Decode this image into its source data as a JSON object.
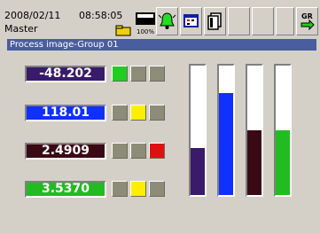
{
  "status": {
    "date": "2008/02/11",
    "time": "08:58:05",
    "mode": "Master",
    "memory": "100%"
  },
  "group_title": "Process image-Group 01",
  "channels": [
    {
      "value": "-48.202",
      "color": "#3a1a6a",
      "alarms": [
        "#22cc22",
        "#8c8c78",
        "#8c8c78"
      ],
      "bar_level": 0.36,
      "bar_color": "#3a1a6a"
    },
    {
      "value": "118.01",
      "color": "#1030ff",
      "alarms": [
        "#8c8c78",
        "#ffee00",
        "#8c8c78"
      ],
      "bar_level": 0.79,
      "bar_color": "#1030ff"
    },
    {
      "value": "2.4909",
      "color": "#3a0a14",
      "alarms": [
        "#8c8c78",
        "#8c8c78",
        "#dd1111"
      ],
      "bar_level": 0.5,
      "bar_color": "#3a0a14"
    },
    {
      "value": "3.5370",
      "color": "#22bb22",
      "alarms": [
        "#8c8c78",
        "#ffee00",
        "#8c8c78"
      ],
      "bar_level": 0.5,
      "bar_color": "#22bb22"
    }
  ]
}
